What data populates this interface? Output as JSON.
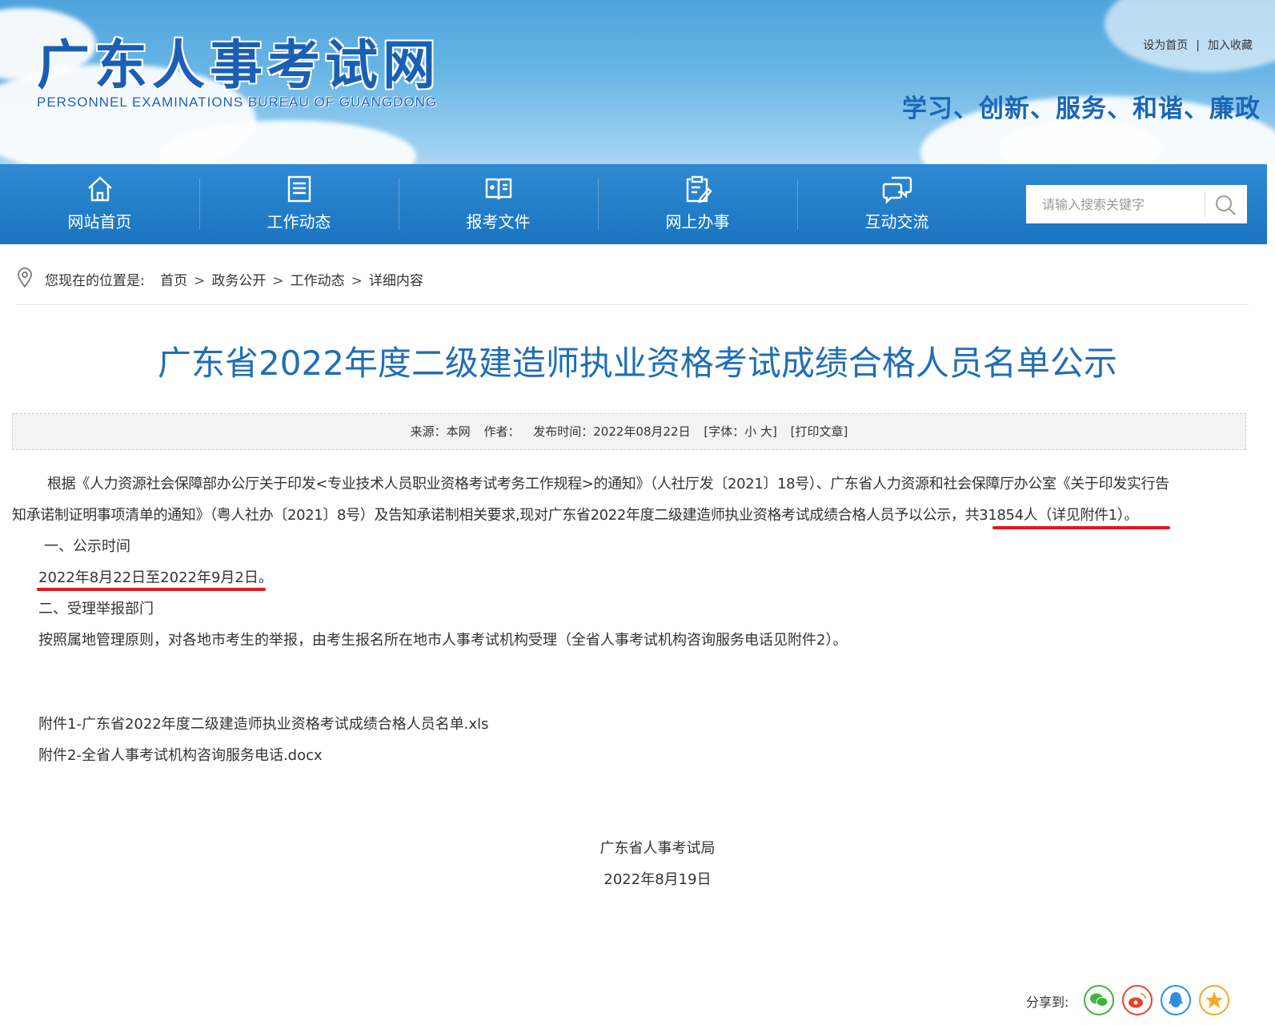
{
  "header": {
    "site_title": "广东人事考试网",
    "site_subtitle": "PERSONNEL EXAMINATIONS BUREAU OF GUANGDONG",
    "set_home": "设为首页",
    "separator": "|",
    "add_favorite": "加入收藏",
    "slogan": "学习、创新、服务、和谐、廉政"
  },
  "nav": {
    "items": [
      {
        "label": "网站首页",
        "icon": "home-icon"
      },
      {
        "label": "工作动态",
        "icon": "document-list-icon"
      },
      {
        "label": "报考文件",
        "icon": "book-icon"
      },
      {
        "label": "网上办事",
        "icon": "edit-form-icon"
      },
      {
        "label": "互动交流",
        "icon": "chat-bubbles-icon"
      }
    ],
    "search_placeholder": "请输入搜索关键字"
  },
  "breadcrumb": {
    "prefix": "您现在的位置是:",
    "items": [
      "首页",
      "政务公开",
      "工作动态",
      "详细内容"
    ],
    "arrow": ">"
  },
  "article": {
    "title": "广东省2022年度二级建造师执业资格考试成绩合格人员名单公示",
    "meta": {
      "source": "来源：本网",
      "author": "作者：",
      "published": "发布时间：2022年08月22日",
      "font_size": "[字体：小 大]",
      "print": "[打印文章]"
    },
    "para1_line1": "根据《人力资源社会保障部办公厅关于印发<专业技术人员职业资格考试考务工作规程>的通知》（人社厅发〔2021〕18号）、广东省人力资源和社会保障厅办公室《关于印发实行告",
    "para1_line2": "知承诺制证明事项清单的通知》（粤人社办〔2021〕8号）及告知承诺制相关要求,现对广东省2022年度二级建造师执业资格考试成绩合格人员予以公示，共31854人（详见附件1）。",
    "section1_heading": "一、公示时间",
    "section1_body": "2022年8月22日至2022年9月2日。",
    "section2_heading": "二、受理举报部门",
    "section2_body": "按照属地管理原则，对各地市考生的举报，由考生报名所在地市人事考试机构受理（全省人事考试机构咨询服务电话见附件2）。",
    "attachments": [
      "附件1-广东省2022年度二级建造师执业资格考试成绩合格人员名单.xls",
      "附件2-全省人事考试机构咨询服务电话.docx"
    ],
    "signature_org": "广东省人事考试局",
    "signature_date": "2022年8月19日"
  },
  "share": {
    "label": "分享到:",
    "buttons": [
      {
        "name": "wechat-icon",
        "color": "#3fb33f"
      },
      {
        "name": "weibo-icon",
        "color": "#e8432c"
      },
      {
        "name": "qq-icon",
        "color": "#2e8fdc"
      },
      {
        "name": "qzone-star-icon",
        "color": "#f3a928"
      }
    ]
  },
  "colors": {
    "nav_blue": "#2280c8",
    "title_blue": "#1f6eb6",
    "annotation_red": "#e3171e"
  }
}
